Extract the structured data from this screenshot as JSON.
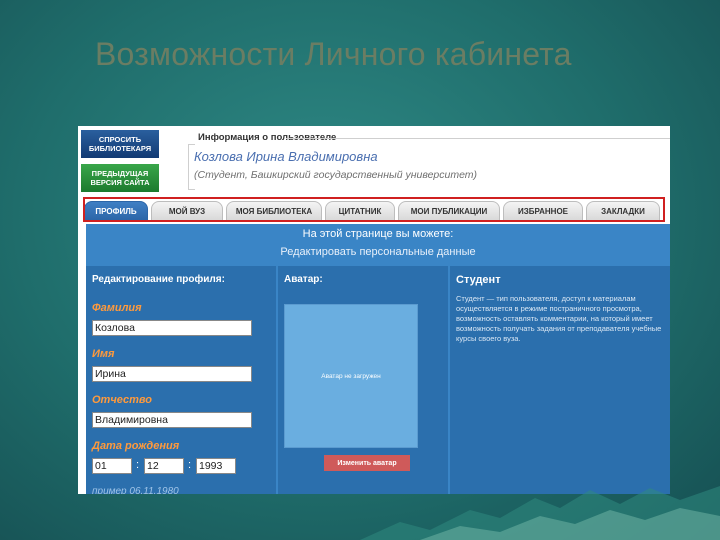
{
  "slide": {
    "title": "Возможности Личного кабинета"
  },
  "side_buttons": {
    "ask": "СПРОСИТЬ БИБЛИОТЕКАРЯ",
    "prev": "ПРЕДЫДУЩАЯ ВЕРСИЯ САЙТА"
  },
  "user_info": {
    "label": "Информация о пользователе",
    "name": "Козлова Ирина Владимировна",
    "status": "(Студент, Башкирский государственный университет)"
  },
  "tabs": [
    {
      "label": "ПРОФИЛЬ",
      "active": true
    },
    {
      "label": "МОЙ ВУЗ"
    },
    {
      "label": "МОЯ БИБЛИОТЕКА"
    },
    {
      "label": "ЦИТАТНИК"
    },
    {
      "label": "МОИ ПУБЛИКАЦИИ"
    },
    {
      "label": "ИЗБРАННОЕ"
    },
    {
      "label": "ЗАКЛАДКИ"
    }
  ],
  "content": {
    "can_head": "На этой странице вы можете:",
    "can_item": "Редактировать персональные данные"
  },
  "profile_edit": {
    "title": "Редактирование профиля:",
    "surname_label": "Фамилия",
    "surname_value": "Козлова",
    "name_label": "Имя",
    "name_value": "Ирина",
    "patronymic_label": "Отчество",
    "patronymic_value": "Владимировна",
    "birth_label": "Дата рождения",
    "birth_day": "01",
    "birth_month": "12",
    "birth_year": "1993",
    "date_sep": ":",
    "date_hint": "пример 06.11.1980"
  },
  "avatar": {
    "title": "Аватар:",
    "placeholder": "Аватар не загружен",
    "change_button": "Изменить аватар"
  },
  "role": {
    "title": "Студент",
    "description": "Студент — тип пользователя, доступ к материалам осуществляется в режиме постраничного просмотра, возможность оставлять комментарии, на который имеет возможность получать задания от преподавателя учебные курсы своего вуза."
  },
  "colors": {
    "tab_highlight": "#d02020",
    "content_blue": "#3a85c6",
    "label_orange": "#ff9a3c"
  }
}
